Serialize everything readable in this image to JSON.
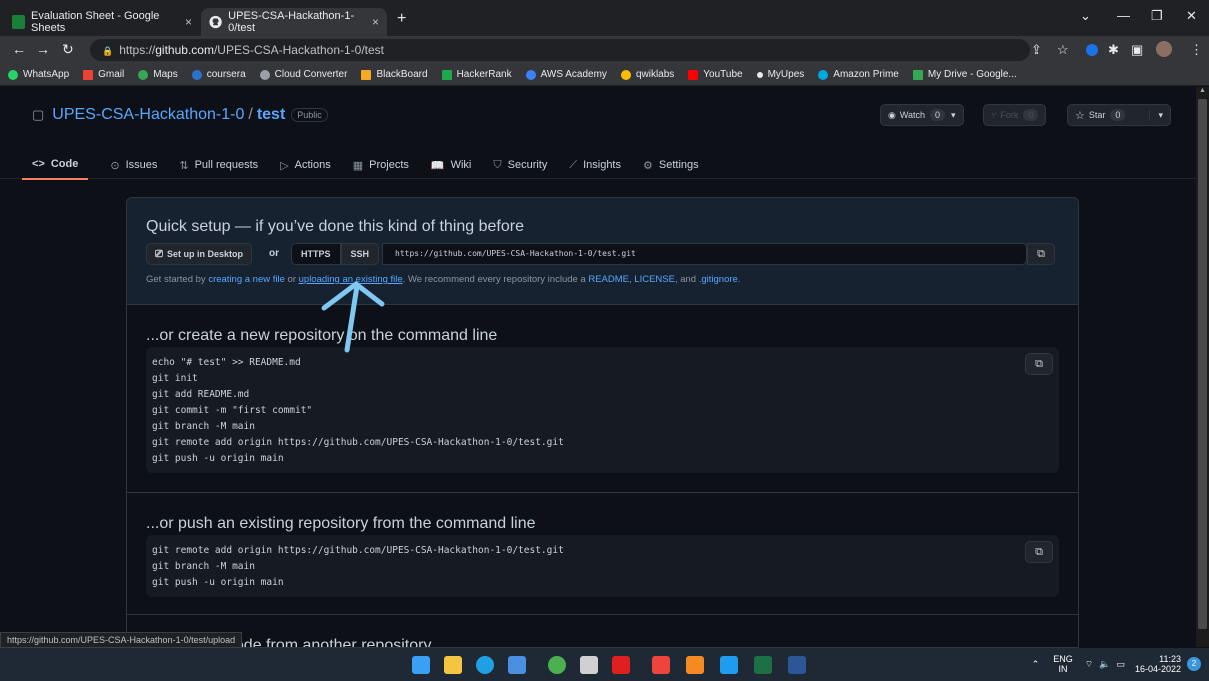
{
  "browser": {
    "tabs": [
      {
        "title": "Evaluation Sheet - Google Sheets",
        "close": "×",
        "icon": "sheets-icon",
        "color": "#188038"
      },
      {
        "title": "UPES-CSA-Hackathon-1-0/test",
        "close": "×",
        "icon": "github-icon"
      }
    ],
    "new_tab": "+",
    "window_controls": [
      "⌄",
      "—",
      "❐",
      "✕"
    ],
    "url_prefix": "https://",
    "url_host": "github.com",
    "url_path": "/UPES-CSA-Hackathon-1-0/test",
    "bookmarks": [
      {
        "label": "WhatsApp",
        "color": "#25d366"
      },
      {
        "label": "Gmail",
        "color": "#ea4335"
      },
      {
        "label": "Maps",
        "color": "#34a853"
      },
      {
        "label": "coursera",
        "color": "#2a73cc"
      },
      {
        "label": "Cloud Converter",
        "color": "#9aa0a6"
      },
      {
        "label": "BlackBoard",
        "color": "#f9a825"
      },
      {
        "label": "HackerRank",
        "color": "#1ba94c"
      },
      {
        "label": "AWS Academy",
        "color": "#3b82f6"
      },
      {
        "label": "qwiklabs",
        "color": "#fbbc04"
      },
      {
        "label": "YouTube",
        "color": "#ff0000"
      },
      {
        "label": "MyUpes",
        "color": "#e8eaed"
      },
      {
        "label": "Amazon Prime",
        "color": "#00a8e1"
      },
      {
        "label": "My Drive - Google...",
        "color": "#34a853"
      }
    ]
  },
  "repo": {
    "owner": "UPES-CSA-Hackathon-1-0",
    "separator": "/",
    "name": "test",
    "visibility": "Public",
    "watch_label": "Watch",
    "watch_count": "0",
    "fork_label": "Fork",
    "fork_count": "0",
    "star_label": "Star",
    "star_count": "0"
  },
  "nav": [
    {
      "label": "Code",
      "icon": "<>"
    },
    {
      "label": "Issues",
      "icon": "⊙"
    },
    {
      "label": "Pull requests",
      "icon": "⇅"
    },
    {
      "label": "Actions",
      "icon": "▷"
    },
    {
      "label": "Projects",
      "icon": "▦"
    },
    {
      "label": "Wiki",
      "icon": "📖"
    },
    {
      "label": "Security",
      "icon": "⛉"
    },
    {
      "label": "Insights",
      "icon": "⟋"
    },
    {
      "label": "Settings",
      "icon": "⚙"
    }
  ],
  "quick_setup": {
    "title": "Quick setup — if you’ve done this kind of thing before",
    "desktop_button": "Set up in Desktop",
    "or": "or",
    "https": "HTTPS",
    "ssh": "SSH",
    "clone_url": "https://github.com/UPES-CSA-Hackathon-1-0/test.git",
    "get_started": "Get started by",
    "creating_link": "creating a new file",
    "or_text": "or",
    "uploading_link": "uploading an existing file",
    "recommend": ". We recommend every repository include a",
    "readme": "README",
    "comma": ",",
    "license": "LICENSE",
    "and": ", and",
    "gitignore": ".gitignore",
    "period": "."
  },
  "create_section": {
    "title": "...or create a new repository on the command line",
    "lines": [
      "echo \"# test\" >> README.md",
      "git init",
      "git add README.md",
      "git commit -m \"first commit\"",
      "git branch -M main",
      "git remote add origin https://github.com/UPES-CSA-Hackathon-1-0/test.git",
      "git push -u origin main"
    ]
  },
  "push_section": {
    "title": "...or push an existing repository from the command line",
    "lines": [
      "git remote add origin https://github.com/UPES-CSA-Hackathon-1-0/test.git",
      "git branch -M main",
      "git push -u origin main"
    ]
  },
  "import_section": {
    "title_partial": "...or import code from another repository"
  },
  "status_url": "https://github.com/UPES-CSA-Hackathon-1-0/test/upload",
  "taskbar": {
    "apps": [
      {
        "name": "windows-start-icon",
        "color": "#3aa0f3"
      },
      {
        "name": "file-explorer-icon",
        "color": "#f4c542"
      },
      {
        "name": "edge-icon",
        "color": "#1fa0e5"
      },
      {
        "name": "store-icon",
        "color": "#4a8fe0"
      },
      {
        "name": "chrome-icon",
        "color": "#4caf50"
      },
      {
        "name": "onenote-icon",
        "color": "#d0d0d0"
      },
      {
        "name": "acrobat-icon",
        "color": "#e02020"
      },
      {
        "name": "anydesk-icon",
        "color": "#ef443b"
      },
      {
        "name": "sublime-icon",
        "color": "#f58a22"
      },
      {
        "name": "vscode-icon",
        "color": "#1f9cf0"
      },
      {
        "name": "excel-icon",
        "color": "#1d7044"
      },
      {
        "name": "word-icon",
        "color": "#2b5797"
      }
    ],
    "lang_top": "ENG",
    "lang_bottom": "IN",
    "time": "11:23",
    "date": "16-04-2022",
    "notification_count": "2"
  }
}
